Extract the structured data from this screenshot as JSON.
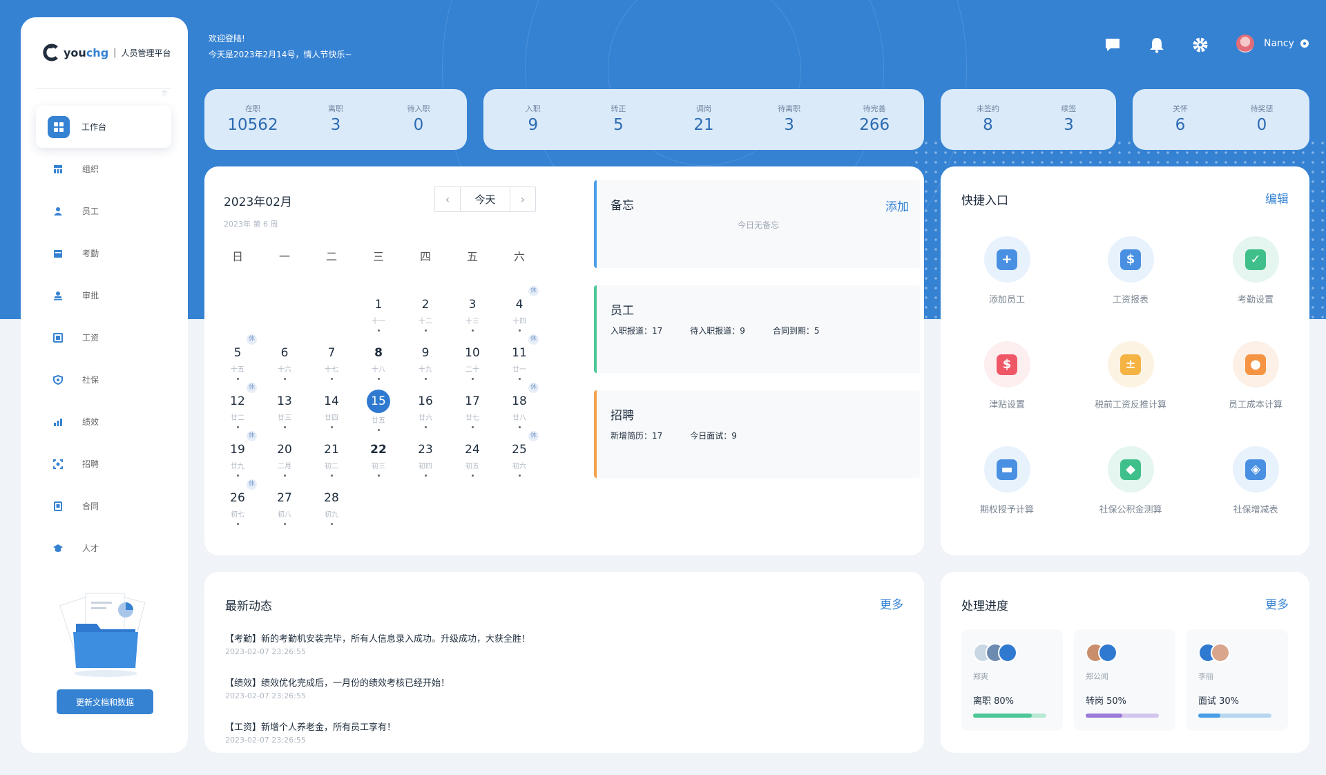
{
  "sidebar": {
    "brand_you": "you",
    "brand_chg": "chg",
    "divider": "|",
    "subtitle": "人员管理平台",
    "collapse_glyph": "☰",
    "items": [
      {
        "label": "工作台",
        "icon": "dashboard-icon"
      },
      {
        "label": "组织",
        "icon": "org-icon"
      },
      {
        "label": "员工",
        "icon": "person-icon"
      },
      {
        "label": "考勤",
        "icon": "calendar-icon"
      },
      {
        "label": "审批",
        "icon": "stamp-icon"
      },
      {
        "label": "工资",
        "icon": "payroll-icon"
      },
      {
        "label": "社保",
        "icon": "shield-icon"
      },
      {
        "label": "绩效",
        "icon": "bar-chart-icon"
      },
      {
        "label": "招聘",
        "icon": "scan-icon"
      },
      {
        "label": "合同",
        "icon": "contract-icon"
      },
      {
        "label": "人才",
        "icon": "graduation-icon"
      }
    ],
    "update_button": "更新文档和数据"
  },
  "header": {
    "welcome": "欢迎登陆!",
    "date_line": "今天是2023年2月14号，情人节快乐~",
    "user_name": "Nancy"
  },
  "stats": [
    [
      {
        "label": "在职",
        "value": "10562"
      },
      {
        "label": "离职",
        "value": "3"
      },
      {
        "label": "待入职",
        "value": "0"
      }
    ],
    [
      {
        "label": "入职",
        "value": "9"
      },
      {
        "label": "转正",
        "value": "5"
      },
      {
        "label": "调岗",
        "value": "21"
      },
      {
        "label": "待离职",
        "value": "3"
      },
      {
        "label": "待完善",
        "value": "266"
      }
    ],
    [
      {
        "label": "未签约",
        "value": "8"
      },
      {
        "label": "续签",
        "value": "3"
      }
    ],
    [
      {
        "label": "关怀",
        "value": "6"
      },
      {
        "label": "待奖惩",
        "value": "0"
      }
    ]
  ],
  "calendar": {
    "title": "2023年02月",
    "week_info": "2023年 第 6 周",
    "prev": "‹",
    "today_label": "今天",
    "next": "›",
    "weekdays": [
      "日",
      "一",
      "二",
      "三",
      "四",
      "五",
      "六"
    ],
    "rest_badge": "休",
    "days": [
      {
        "n": "1",
        "l": "十一",
        "col": 3,
        "row": 0
      },
      {
        "n": "2",
        "l": "十二",
        "col": 4,
        "row": 0
      },
      {
        "n": "3",
        "l": "十三",
        "col": 5,
        "row": 0
      },
      {
        "n": "4",
        "l": "十四",
        "col": 6,
        "row": 0,
        "rest": true
      },
      {
        "n": "5",
        "l": "十五",
        "col": 0,
        "row": 1,
        "rest": true
      },
      {
        "n": "6",
        "l": "十六",
        "col": 1,
        "row": 1
      },
      {
        "n": "7",
        "l": "十七",
        "col": 2,
        "row": 1
      },
      {
        "n": "8",
        "l": "十八",
        "col": 3,
        "row": 1,
        "bold": true
      },
      {
        "n": "9",
        "l": "十九",
        "col": 4,
        "row": 1
      },
      {
        "n": "10",
        "l": "二十",
        "col": 5,
        "row": 1
      },
      {
        "n": "11",
        "l": "廿一",
        "col": 6,
        "row": 1,
        "rest": true
      },
      {
        "n": "12",
        "l": "廿二",
        "col": 0,
        "row": 2,
        "rest": true
      },
      {
        "n": "13",
        "l": "廿三",
        "col": 1,
        "row": 2
      },
      {
        "n": "14",
        "l": "廿四",
        "col": 2,
        "row": 2
      },
      {
        "n": "15",
        "l": "廿五",
        "col": 3,
        "row": 2,
        "today": true
      },
      {
        "n": "16",
        "l": "廿六",
        "col": 4,
        "row": 2
      },
      {
        "n": "17",
        "l": "廿七",
        "col": 5,
        "row": 2
      },
      {
        "n": "18",
        "l": "廿八",
        "col": 6,
        "row": 2,
        "rest": true
      },
      {
        "n": "19",
        "l": "廿九",
        "col": 0,
        "row": 3,
        "rest": true
      },
      {
        "n": "20",
        "l": "二月",
        "col": 1,
        "row": 3
      },
      {
        "n": "21",
        "l": "初二",
        "col": 2,
        "row": 3
      },
      {
        "n": "22",
        "l": "初三",
        "col": 3,
        "row": 3,
        "bold": true
      },
      {
        "n": "23",
        "l": "初四",
        "col": 4,
        "row": 3
      },
      {
        "n": "24",
        "l": "初五",
        "col": 5,
        "row": 3
      },
      {
        "n": "25",
        "l": "初六",
        "col": 6,
        "row": 3,
        "rest": true
      },
      {
        "n": "26",
        "l": "初七",
        "col": 0,
        "row": 4,
        "rest": true
      },
      {
        "n": "27",
        "l": "初八",
        "col": 1,
        "row": 4
      },
      {
        "n": "28",
        "l": "初九",
        "col": 2,
        "row": 4
      }
    ]
  },
  "memo": {
    "title": "备忘",
    "add": "添加",
    "empty": "今日无备忘"
  },
  "employee": {
    "title": "员工",
    "items": [
      "入职报道：17",
      "待入职报道：9",
      "合同到期：5"
    ]
  },
  "recruit": {
    "title": "招聘",
    "items": [
      "新增简历：17",
      "今日面试：9"
    ]
  },
  "quick": {
    "title": "快捷入口",
    "edit": "编辑",
    "items": [
      {
        "label": "添加员工",
        "bg": "#e8f2fd",
        "fg": "#4a90e2",
        "glyph": "+"
      },
      {
        "label": "工资报表",
        "bg": "#e8f2fd",
        "fg": "#4a90e2",
        "glyph": "$"
      },
      {
        "label": "考勤设置",
        "bg": "#e4f6ef",
        "fg": "#3fbf8a",
        "glyph": "✓"
      },
      {
        "label": "津贴设置",
        "bg": "#fdeef0",
        "fg": "#ef5767",
        "glyph": "$"
      },
      {
        "label": "税前工资反推计算",
        "bg": "#fdf3e3",
        "fg": "#f5b343",
        "glyph": "±"
      },
      {
        "label": "员工成本计算",
        "bg": "#fdf0e6",
        "fg": "#f59443",
        "glyph": "●"
      },
      {
        "label": "期权授予计算",
        "bg": "#e8f2fd",
        "fg": "#4a90e2",
        "glyph": "▬"
      },
      {
        "label": "社保公积金测算",
        "bg": "#e4f6ef",
        "fg": "#3fbf8a",
        "glyph": "◆"
      },
      {
        "label": "社保增减表",
        "bg": "#e8f2fd",
        "fg": "#4a90e2",
        "glyph": "◈"
      }
    ]
  },
  "news": {
    "title": "最新动态",
    "more": "更多",
    "items": [
      {
        "text": "【考勤】新的考勤机安装完毕，所有人信息录入成功。升级成功，大获全胜！",
        "time": "2023-02-07  23:26:55"
      },
      {
        "text": "【绩效】绩效优化完成后，一月份的绩效考核已经开始！",
        "time": "2023-02-07  23:26:55"
      },
      {
        "text": "【工资】新增个人养老金，所有员工享有！",
        "time": "2023-02-07  23:26:55"
      }
    ]
  },
  "progress": {
    "title": "处理进度",
    "more": "更多",
    "items": [
      {
        "name": "郑爽",
        "status": "离职 80%",
        "percent": 80,
        "color": "#4cc795",
        "track": "#b7e8d2"
      },
      {
        "name": "郑公闻",
        "status": "转岗 50%",
        "percent": 50,
        "color": "#9a7ad8",
        "track": "#d4c5ef"
      },
      {
        "name": "李丽",
        "status": "面试 30%",
        "percent": 30,
        "color": "#4a9ee8",
        "track": "#b8d6f0"
      }
    ]
  }
}
